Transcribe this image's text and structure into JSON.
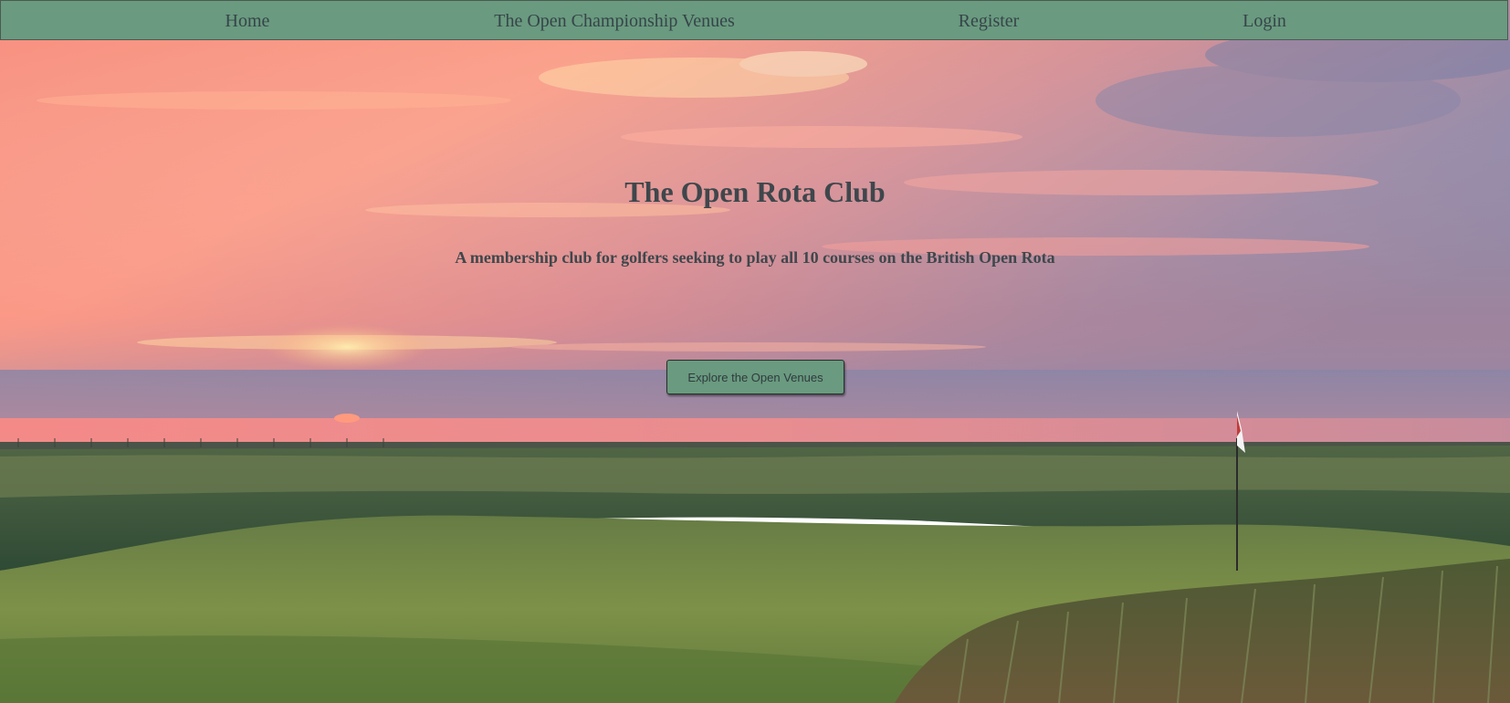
{
  "nav": {
    "items": [
      {
        "label": "Home"
      },
      {
        "label": "The Open Championship Venues"
      },
      {
        "label": "Register"
      },
      {
        "label": "Login"
      }
    ]
  },
  "hero": {
    "title": "The Open Rota Club",
    "subtitle": "A membership club for golfers seeking to play all 10 courses on the British Open Rota",
    "cta_label": "Explore the Open Venues"
  },
  "colors": {
    "nav_background": "#6a9a7f",
    "nav_text": "#36454a",
    "heading_text": "#3e474c",
    "button_background": "#6a9a7f"
  }
}
